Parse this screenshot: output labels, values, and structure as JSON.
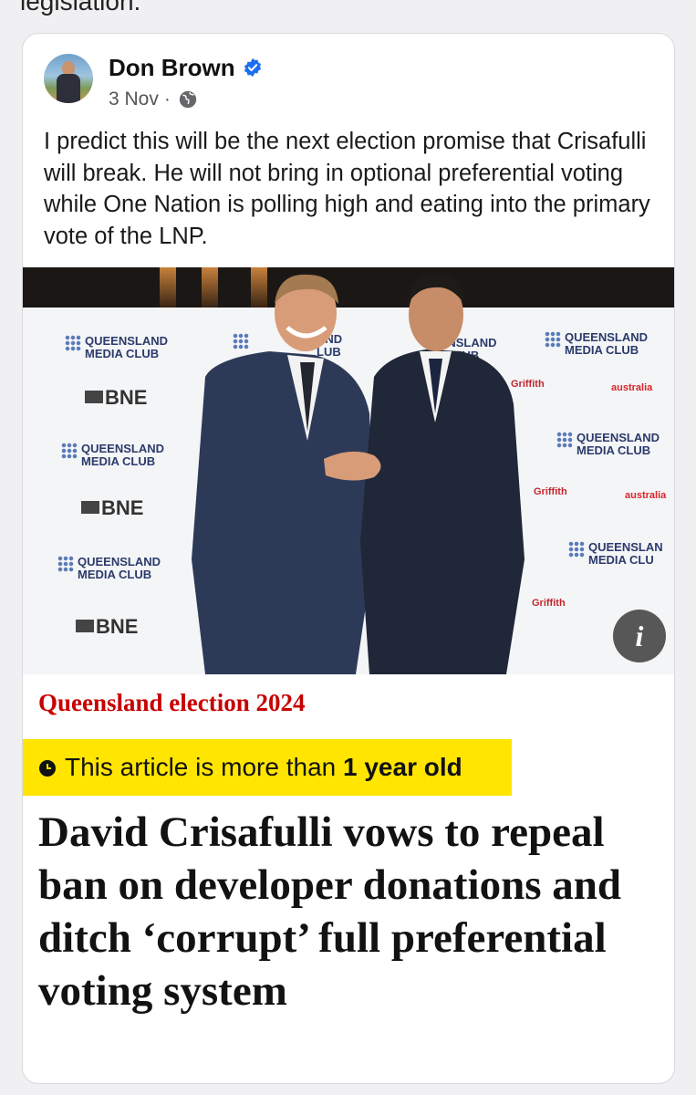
{
  "top_snippet": "legislation.",
  "post": {
    "author": "Don Brown",
    "date": "3 Nov",
    "separator": "·",
    "text": "I predict this will be the next election promise that Crisafulli will break. He will not bring in optional preferential voting while One Nation is polling high and eating into the primary vote of the LNP."
  },
  "photo": {
    "backdrop_logos": {
      "qmc_line1": "QUEENSLAND",
      "qmc_line2": "MEDIA CLUB",
      "qmc_partial1_line1": "AND",
      "qmc_partial1_line2": "LUB",
      "qmc_partial2_line1": "EENSLAND",
      "qmc_partial2_line2": "IA CLUB",
      "qmc_partial3_line1": "QUEENSLAN",
      "qmc_partial3_line2": "MEDIA CLU",
      "bne": "BNE",
      "griffith": "Griffith",
      "virgin": "australia"
    },
    "info_glyph": "i"
  },
  "article": {
    "kicker": "Queensland election 2024",
    "age_prefix": "This article is more than ",
    "age_bold": "1 year old",
    "headline": "David Crisafulli vows to repeal ban on developer donations and ditch ‘corrupt’ full preferential voting system"
  },
  "icons": {
    "verified": "verified-badge-icon",
    "audience": "globe-icon",
    "clock": "clock-icon",
    "info": "info-icon"
  },
  "colors": {
    "verified_blue": "#1d6ff2",
    "kicker_red": "#c70000",
    "badge_yellow": "#ffe500"
  }
}
